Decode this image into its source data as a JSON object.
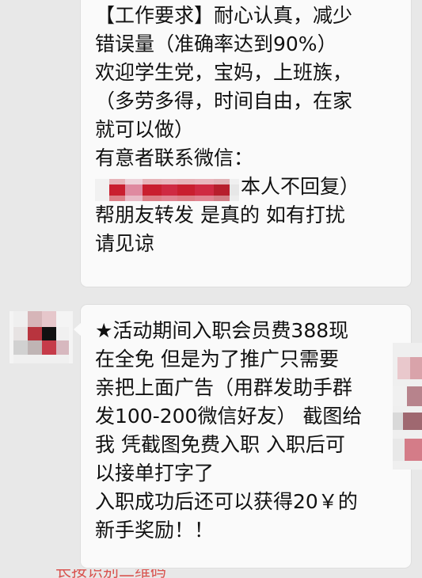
{
  "messages": [
    {
      "lines": [
        "【工作要求】耐心认真，减少",
        "错误量（准确率达到90%）",
        "欢迎学生党，宝妈，上班族，",
        "（多劳多得，时间自由，在家",
        "就可以做）",
        "有意者联系微信：",
        "本人不回复）",
        "帮朋友转发  是真的   如有打扰",
        "请见谅"
      ]
    },
    {
      "lines": [
        "★活动期间入职会员费388现",
        "在全免   但是为了推广只需要",
        "亲把上面广告（用群发助手群",
        "发100-200微信好友）  截图给",
        "我  凭截图免费入职  入职后可",
        "以接单打字了",
        "入职成功后还可以获得20￥的",
        "新手奖励！！"
      ]
    }
  ]
}
